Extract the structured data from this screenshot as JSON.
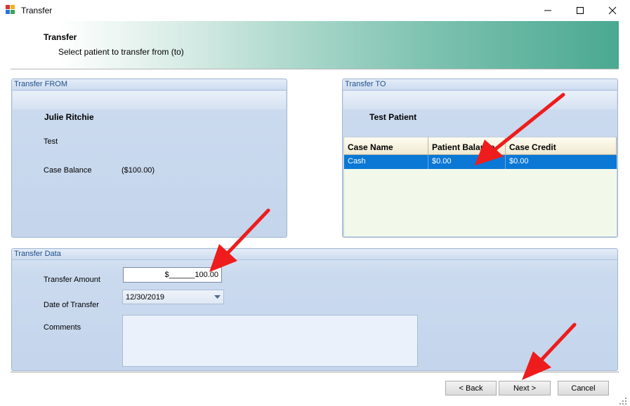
{
  "window": {
    "title": "Transfer",
    "app_icon": "windows-forms-app-icon",
    "controls": [
      "minimize-icon",
      "maximize-icon",
      "close-icon"
    ]
  },
  "banner": {
    "title": "Transfer",
    "subtitle": "Select patient to transfer from (to)"
  },
  "from": {
    "heading": "Transfer FROM",
    "patient_name": "Julie Ritchie",
    "case_name": "Test",
    "balance_label": "Case Balance",
    "balance_value": "($100.00)"
  },
  "to": {
    "heading": "Transfer TO",
    "patient_name": "Test Patient",
    "grid": {
      "columns": [
        "Case Name",
        "Patient Balance",
        "Case Credit"
      ],
      "rows": [
        [
          "Cash",
          "$0.00",
          "$0.00"
        ]
      ],
      "selected_row": 0
    }
  },
  "data": {
    "heading": "Transfer Data",
    "amount_label": "Transfer Amount",
    "amount_value": "$______100.00",
    "date_label": "Date of Transfer",
    "date_value": "12/30/2019",
    "comments_label": "Comments",
    "comments_value": ""
  },
  "buttons": {
    "back": "< Back",
    "next": "Next >",
    "cancel": "Cancel"
  },
  "colors": {
    "selection": "#0b78d6",
    "annotation_arrow": "#ee1c1c",
    "panel_heading": "#1e4e8c",
    "banner_accent": "#4aa991"
  }
}
